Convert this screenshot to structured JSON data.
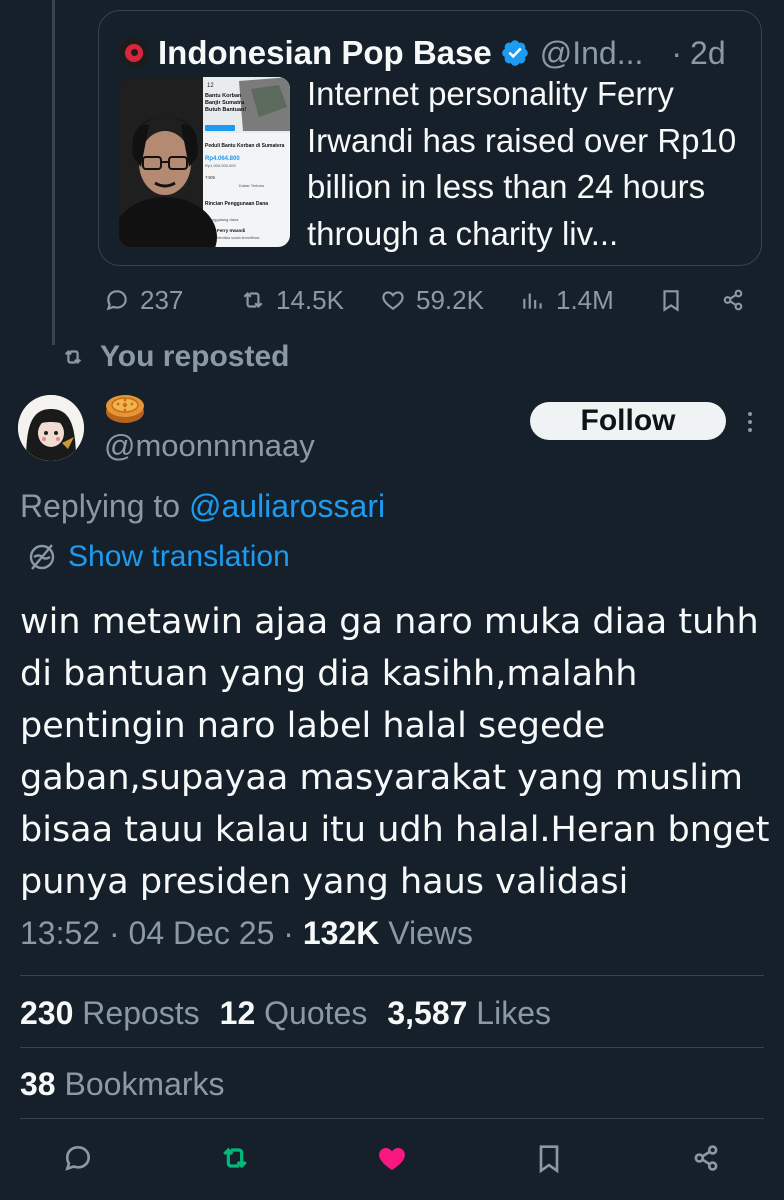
{
  "quoted_tweet": {
    "author_name": "Indonesian Pop Base",
    "handle": "@Ind...",
    "separator": "·",
    "time": "2d",
    "text": "Internet personality Ferry Irwandi has raised over Rp10 billion in less than 24 hours through a charity liv...",
    "thumbnail": {
      "alt_texts": [
        "12",
        "Bantu Korban",
        "Banjir Sumatra",
        "Butuh Bantuan!",
        "Peduli Bantu Korban di Sumatera",
        "Rp4.064.800",
        "Rp1.000.000.000",
        "7405",
        "Kabar Terbaru",
        "Rincian Penggunaan Dana",
        "Penggalang dana",
        "Ferry Irwandi",
        "Identitas sudah terverifikasi"
      ]
    },
    "actions": {
      "replies": "237",
      "reposts": "14.5K",
      "likes": "59.2K",
      "views": "1.4M"
    }
  },
  "repost_label": "You reposted",
  "tweet": {
    "handle": "@moonnnnaay",
    "follow_label": "Follow",
    "replying_prefix": "Replying to",
    "replying_to": "@auliarossari",
    "show_translation": "Show translation",
    "text": "win metawin ajaa ga naro muka diaa tuhh di bantuan yang dia kasihh,malahh pentingin naro label halal segede gaban,supayaa masyarakat yang muslim bisaa tauu kalau itu udh halal.Heran bnget punya presiden yang haus validasi",
    "time": "13:52",
    "date": "04 Dec 25",
    "views_count": "132K",
    "views_label": "Views",
    "reposts_count": "230",
    "reposts_label": "Reposts",
    "quotes_count": "12",
    "quotes_label": "Quotes",
    "likes_count": "3,587",
    "likes_label": "Likes",
    "bookmarks_count": "38",
    "bookmarks_label": "Bookmarks"
  },
  "colors": {
    "background": "#15202b",
    "text": "#f7f9f9",
    "muted": "#8b98a5",
    "accent": "#1d9bf0",
    "repost_active": "#00ba7c",
    "like_active": "#f91880",
    "border": "#38444d"
  },
  "icons": [
    "reply-icon",
    "repost-icon",
    "like-icon",
    "views-icon",
    "bookmark-icon",
    "share-icon",
    "verified-icon",
    "translate-icon",
    "more-icon",
    "mooncake-emoji"
  ]
}
